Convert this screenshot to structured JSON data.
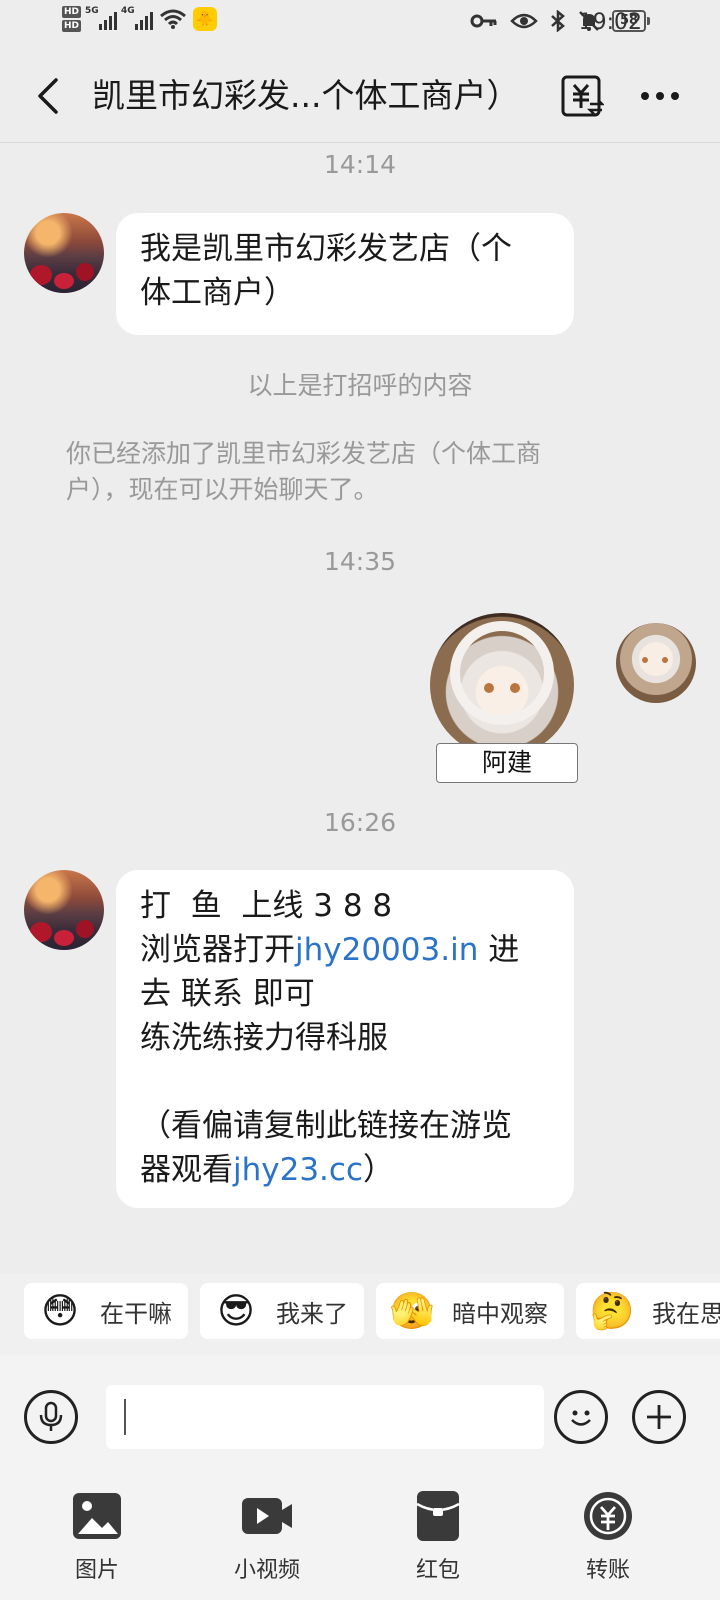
{
  "status_bar": {
    "network_labels": [
      "HD",
      "HD"
    ],
    "signal_labels": [
      "5G",
      "4G"
    ],
    "battery": "58",
    "time": "19:02"
  },
  "header": {
    "title": "凯里市幻彩发...个体工商户）"
  },
  "chat": {
    "timestamps": [
      "14:14",
      "14:35",
      "16:26"
    ],
    "greeting_message": [
      "我是凯里市幻彩发艺店（个",
      "体工商户）"
    ],
    "system_greeting_note": "以上是打招呼的内容",
    "system_added_note": [
      "你已经添加了凯里市幻彩发艺店（个体工商",
      "户），现在可以开始聊天了。"
    ],
    "sticker_name": "阿建",
    "ad_message": {
      "line1": "打  鱼  上线 3 8 8",
      "line2_prefix": "浏览器打开",
      "line2_link": "jhy20003.in",
      "line2_suffix": " 进",
      "line3": "去 联系 即可",
      "line4": "练洗练接力得科服",
      "line5": "（看偏请复制此链接在游览",
      "line6_prefix": "器观看",
      "line6_link": "jhy23.cc",
      "line6_suffix": "）"
    }
  },
  "quick_replies": [
    {
      "icon": "sticker-what-are-you-doing",
      "label": "在干嘛"
    },
    {
      "icon": "sticker-sunglasses",
      "label": "我来了"
    },
    {
      "icon": "sticker-peeking",
      "label": "暗中观察"
    },
    {
      "icon": "sticker-thinking",
      "label": "我在思考"
    }
  ],
  "input": {
    "placeholder": ""
  },
  "bottom_menu": [
    {
      "icon": "image-icon",
      "label": "图片"
    },
    {
      "icon": "video-icon",
      "label": "小视频"
    },
    {
      "icon": "red-packet-icon",
      "label": "红包"
    },
    {
      "icon": "transfer-icon",
      "label": "转账"
    }
  ],
  "colors": {
    "background": "#ededed",
    "bubble": "#ffffff",
    "link": "#2a73c9",
    "meta_text": "#999999"
  }
}
